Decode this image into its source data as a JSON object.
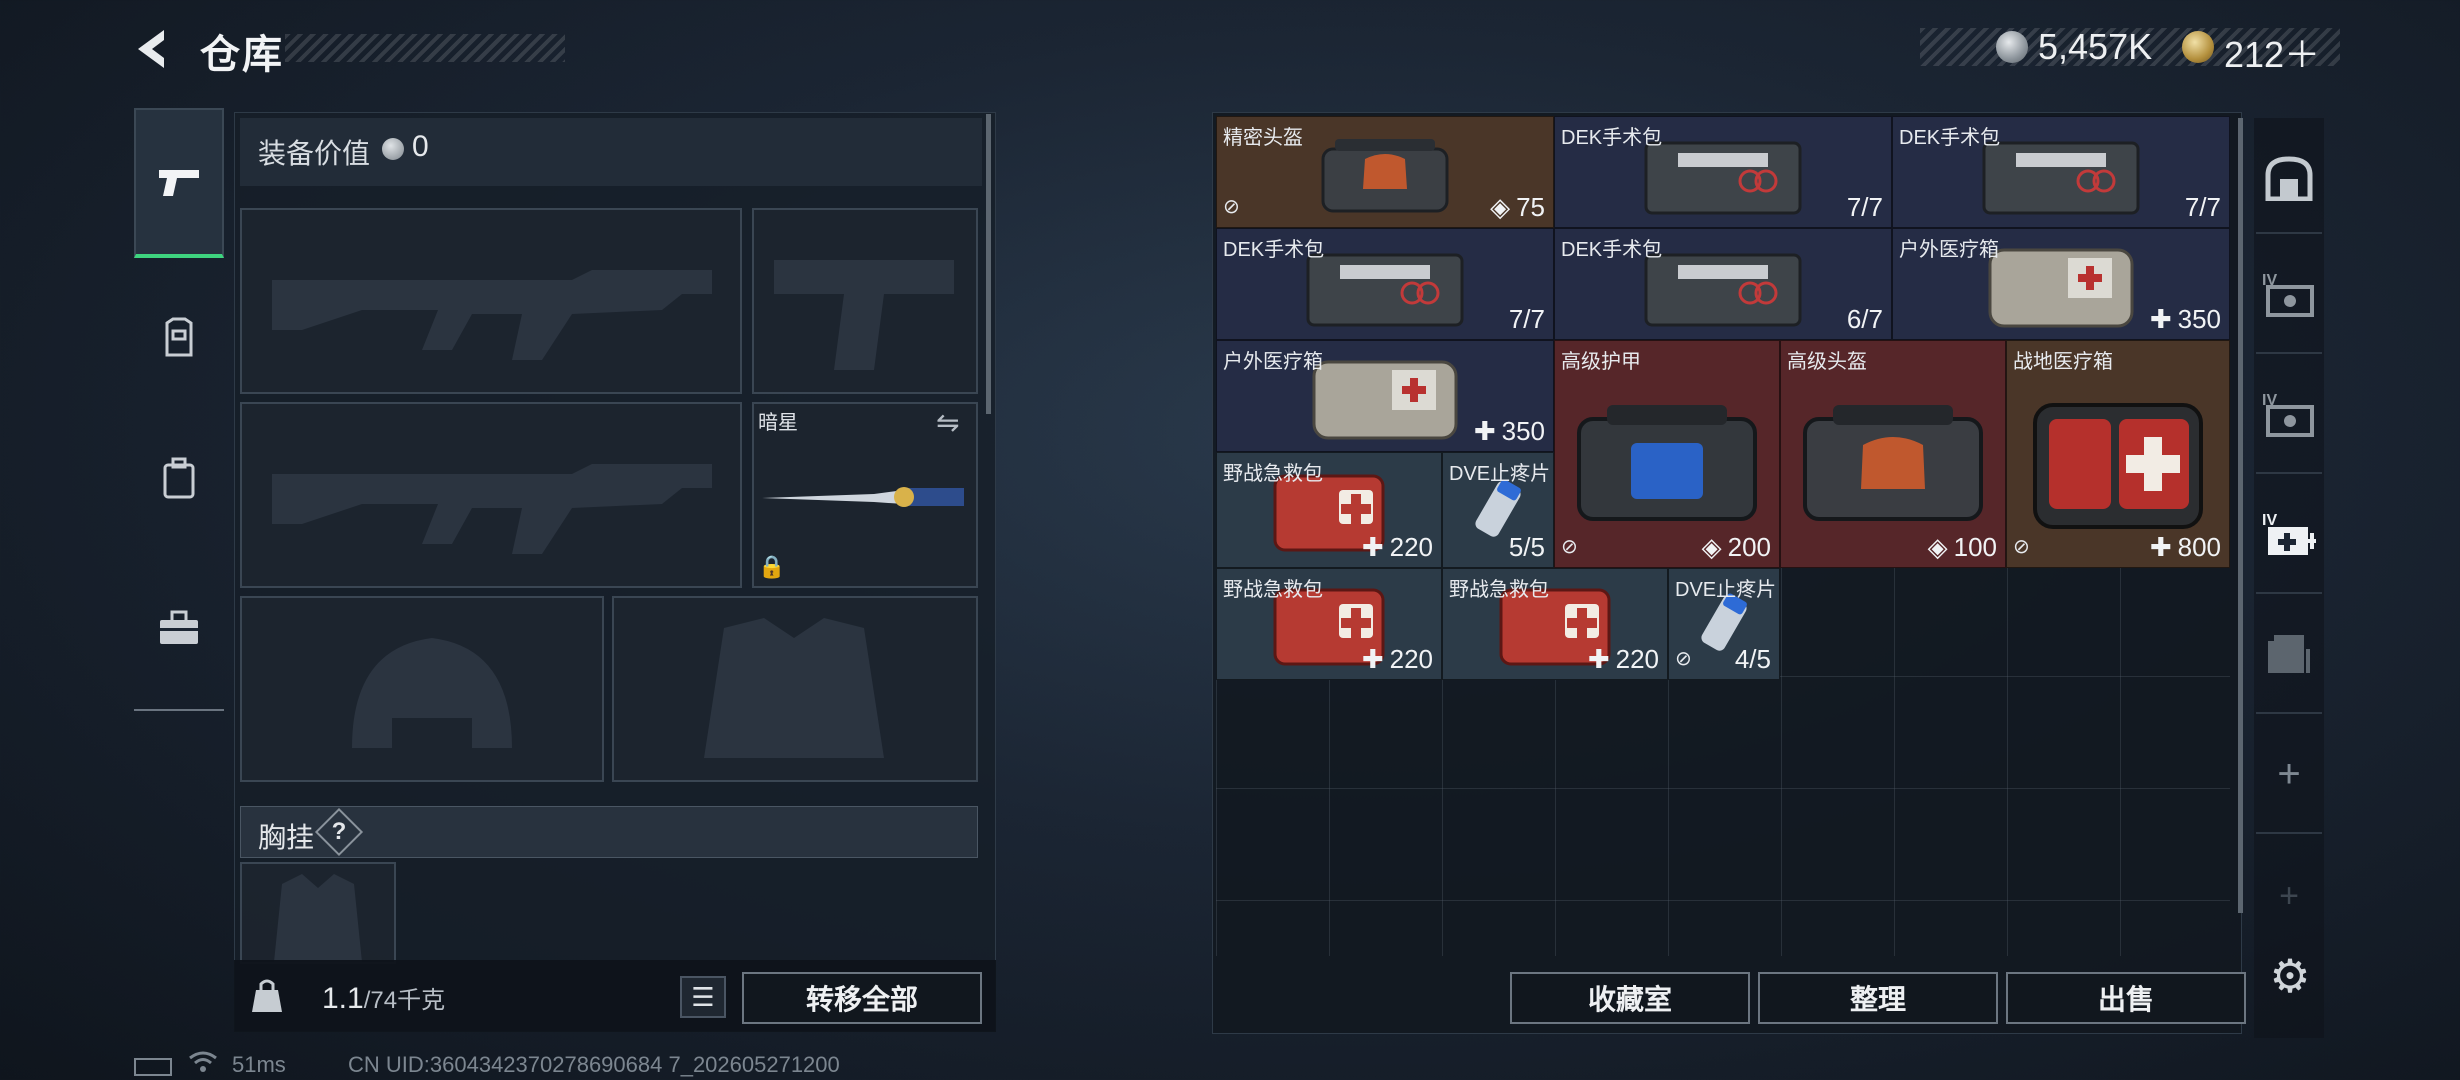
{
  "header": {
    "title": "仓库",
    "silver_value": "5,457K",
    "gold_value": "212＋"
  },
  "tabs": [
    {
      "name": "weapons",
      "icon": "pistol-icon",
      "active": true
    },
    {
      "name": "rig",
      "icon": "rig-icon"
    },
    {
      "name": "backpack",
      "icon": "backpack-icon"
    },
    {
      "name": "case",
      "icon": "case-icon"
    }
  ],
  "equipment": {
    "value_label": "装备价值",
    "value": "0",
    "melee_name": "暗星",
    "chest_label": "胸挂",
    "chest_help": "?"
  },
  "weight": {
    "current": "1.1",
    "max": "/74千克"
  },
  "buttons": {
    "transfer_all": "转移全部",
    "collection": "收藏室",
    "sort": "整理",
    "sell": "出售"
  },
  "items": [
    {
      "name": "精密头盔",
      "value": "75",
      "value_icon": "shield-icon",
      "no_insure": true,
      "color": "#4a3628"
    },
    {
      "name": "DEK手术包",
      "value": "7/7",
      "color": "#252c45"
    },
    {
      "name": "DEK手术包",
      "value": "7/7",
      "color": "#252c45"
    },
    {
      "name": "DEK手术包",
      "value": "7/7",
      "color": "#252c45"
    },
    {
      "name": "DEK手术包",
      "value": "6/7",
      "color": "#252c45"
    },
    {
      "name": "户外医疗箱",
      "value": "350",
      "value_icon": "plus-icon",
      "color": "#252c45"
    },
    {
      "name": "户外医疗箱",
      "value": "350",
      "value_icon": "plus-icon",
      "color": "#252c45"
    },
    {
      "name": "高级护甲",
      "value": "200",
      "value_icon": "shield-icon",
      "no_insure": true,
      "color": "#562629"
    },
    {
      "name": "高级头盔",
      "value": "100",
      "value_icon": "shield-icon",
      "color": "#562629"
    },
    {
      "name": "战地医疗箱",
      "value": "800",
      "value_icon": "plus-icon",
      "no_insure": true,
      "color": "#4a3628"
    },
    {
      "name": "野战急救包",
      "value": "220",
      "value_icon": "plus-icon",
      "color": "#2c3b48"
    },
    {
      "name": "DVE止疼片",
      "value": "5/5",
      "color": "#2c3b48"
    },
    {
      "name": "野战急救包",
      "value": "220",
      "value_icon": "plus-icon",
      "color": "#2c3b48"
    },
    {
      "name": "野战急救包",
      "value": "220",
      "value_icon": "plus-icon",
      "color": "#2c3b48"
    },
    {
      "name": "DVE止疼片",
      "value": "4/5",
      "no_insure": true,
      "color": "#2c3b48"
    }
  ],
  "sidebar_icons": [
    "safe-box-icon",
    "iv-key-case-icon",
    "iv-key-case-icon",
    "iv-medkit-icon",
    "file-case-icon",
    "add-icon",
    "add-icon",
    "gear-icon"
  ],
  "status": {
    "ping": "51ms",
    "uid": "CN UID:3604342370278690684 7_202605271200"
  }
}
